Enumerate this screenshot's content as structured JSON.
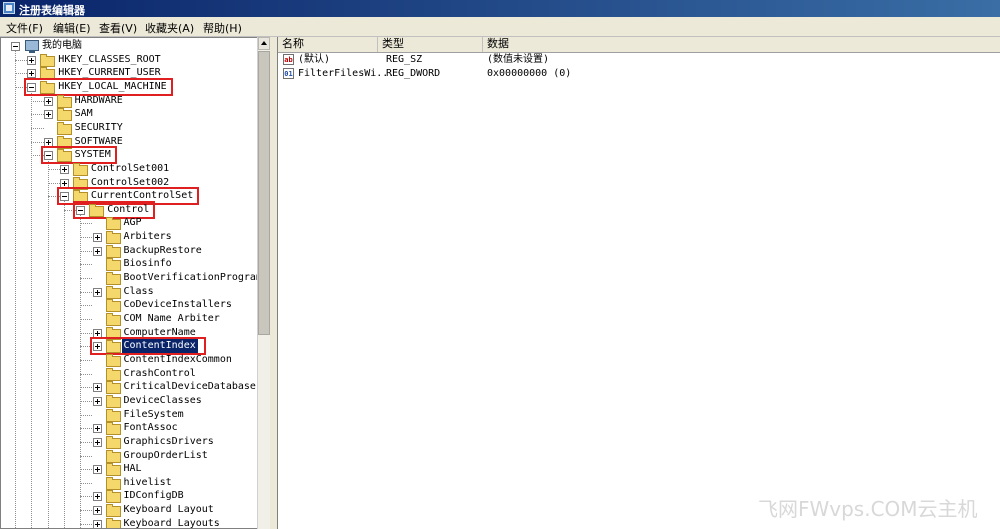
{
  "window": {
    "title": "注册表编辑器"
  },
  "menu": [
    "文件(F)",
    "编辑(E)",
    "查看(V)",
    "收藏夹(A)",
    "帮助(H)"
  ],
  "tree": {
    "root": "我的电脑",
    "nodes": [
      {
        "label": "HKEY_CLASSES_ROOT",
        "level": 1,
        "expander": "plus",
        "highlight": false,
        "selected": false
      },
      {
        "label": "HKEY_CURRENT_USER",
        "level": 1,
        "expander": "plus",
        "highlight": false,
        "selected": false
      },
      {
        "label": "HKEY_LOCAL_MACHINE",
        "level": 1,
        "expander": "minus",
        "highlight": true,
        "selected": false
      },
      {
        "label": "HARDWARE",
        "level": 2,
        "expander": "plus",
        "highlight": false,
        "selected": false
      },
      {
        "label": "SAM",
        "level": 2,
        "expander": "plus",
        "highlight": false,
        "selected": false
      },
      {
        "label": "SECURITY",
        "level": 2,
        "expander": "none",
        "highlight": false,
        "selected": false
      },
      {
        "label": "SOFTWARE",
        "level": 2,
        "expander": "plus",
        "highlight": false,
        "selected": false
      },
      {
        "label": "SYSTEM",
        "level": 2,
        "expander": "minus",
        "highlight": true,
        "selected": false
      },
      {
        "label": "ControlSet001",
        "level": 3,
        "expander": "plus",
        "highlight": false,
        "selected": false
      },
      {
        "label": "ControlSet002",
        "level": 3,
        "expander": "plus",
        "highlight": false,
        "selected": false
      },
      {
        "label": "CurrentControlSet",
        "level": 3,
        "expander": "minus",
        "highlight": true,
        "selected": false
      },
      {
        "label": "Control",
        "level": 4,
        "expander": "minus",
        "highlight": true,
        "selected": false
      },
      {
        "label": "AGP",
        "level": 5,
        "expander": "none",
        "highlight": false,
        "selected": false
      },
      {
        "label": "Arbiters",
        "level": 5,
        "expander": "plus",
        "highlight": false,
        "selected": false
      },
      {
        "label": "BackupRestore",
        "level": 5,
        "expander": "plus",
        "highlight": false,
        "selected": false
      },
      {
        "label": "Biosinfo",
        "level": 5,
        "expander": "none",
        "highlight": false,
        "selected": false
      },
      {
        "label": "BootVerificationProgram",
        "level": 5,
        "expander": "none",
        "highlight": false,
        "selected": false
      },
      {
        "label": "Class",
        "level": 5,
        "expander": "plus",
        "highlight": false,
        "selected": false
      },
      {
        "label": "CoDeviceInstallers",
        "level": 5,
        "expander": "none",
        "highlight": false,
        "selected": false
      },
      {
        "label": "COM Name Arbiter",
        "level": 5,
        "expander": "none",
        "highlight": false,
        "selected": false
      },
      {
        "label": "ComputerName",
        "level": 5,
        "expander": "plus",
        "highlight": false,
        "selected": false
      },
      {
        "label": "ContentIndex",
        "level": 5,
        "expander": "plus",
        "highlight": true,
        "selected": true
      },
      {
        "label": "ContentIndexCommon",
        "level": 5,
        "expander": "none",
        "highlight": false,
        "selected": false
      },
      {
        "label": "CrashControl",
        "level": 5,
        "expander": "none",
        "highlight": false,
        "selected": false
      },
      {
        "label": "CriticalDeviceDatabase",
        "level": 5,
        "expander": "plus",
        "highlight": false,
        "selected": false
      },
      {
        "label": "DeviceClasses",
        "level": 5,
        "expander": "plus",
        "highlight": false,
        "selected": false
      },
      {
        "label": "FileSystem",
        "level": 5,
        "expander": "none",
        "highlight": false,
        "selected": false
      },
      {
        "label": "FontAssoc",
        "level": 5,
        "expander": "plus",
        "highlight": false,
        "selected": false
      },
      {
        "label": "GraphicsDrivers",
        "level": 5,
        "expander": "plus",
        "highlight": false,
        "selected": false
      },
      {
        "label": "GroupOrderList",
        "level": 5,
        "expander": "none",
        "highlight": false,
        "selected": false
      },
      {
        "label": "HAL",
        "level": 5,
        "expander": "plus",
        "highlight": false,
        "selected": false
      },
      {
        "label": "hivelist",
        "level": 5,
        "expander": "none",
        "highlight": false,
        "selected": false
      },
      {
        "label": "IDConfigDB",
        "level": 5,
        "expander": "plus",
        "highlight": false,
        "selected": false
      },
      {
        "label": "Keyboard Layout",
        "level": 5,
        "expander": "plus",
        "highlight": false,
        "selected": false
      },
      {
        "label": "Keyboard Layouts",
        "level": 5,
        "expander": "plus",
        "highlight": false,
        "selected": false
      }
    ]
  },
  "list": {
    "columns": [
      "名称",
      "类型",
      "数据"
    ],
    "rows": [
      {
        "icon": "string-value-icon",
        "name": "(默认)",
        "type": "REG_SZ",
        "data": "(数值未设置)"
      },
      {
        "icon": "binary-value-icon",
        "name": "FilterFilesWi...",
        "type": "REG_DWORD",
        "data": "0x00000000 (0)"
      }
    ]
  },
  "watermark": "飞网FWvps.COM云主机",
  "colors": {
    "title_bar": "#0a246a",
    "selection": "#0a246a",
    "highlight_box": "#e02020",
    "folder": "#f4d86b"
  }
}
